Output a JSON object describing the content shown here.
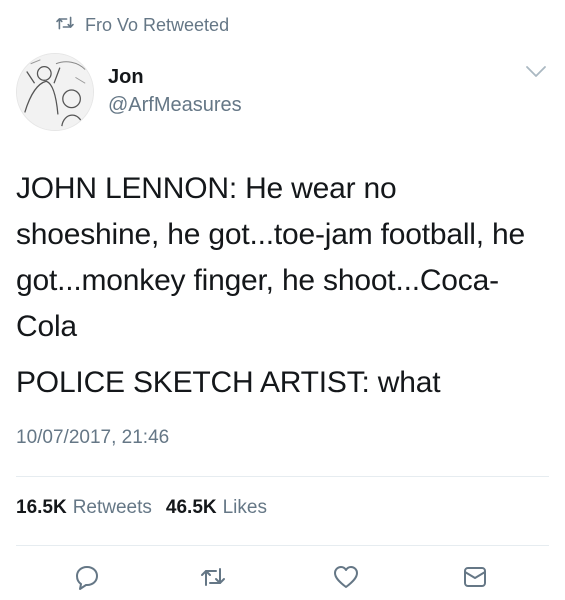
{
  "retweet_context": {
    "icon": "retweet-icon",
    "text": "Fro Vo Retweeted"
  },
  "author": {
    "display_name": "Jon",
    "handle": "@ArfMeasures",
    "avatar_icon": "avatar-image"
  },
  "tweet": {
    "paragraphs": [
      "JOHN LENNON: He wear no shoeshine, he got...toe-jam football, he got...monkey finger, he shoot...Coca-Cola",
      "POLICE SKETCH ARTIST: what"
    ],
    "timestamp": "10/07/2017, 21:46"
  },
  "stats": {
    "retweets_count": "16.5K",
    "retweets_label": "Retweets",
    "likes_count": "46.5K",
    "likes_label": "Likes"
  },
  "actions": [
    "reply-icon",
    "retweet-icon",
    "like-icon",
    "message-icon"
  ],
  "colors": {
    "text": "#14171a",
    "secondary": "#657786",
    "divider": "#e6ecf0"
  }
}
